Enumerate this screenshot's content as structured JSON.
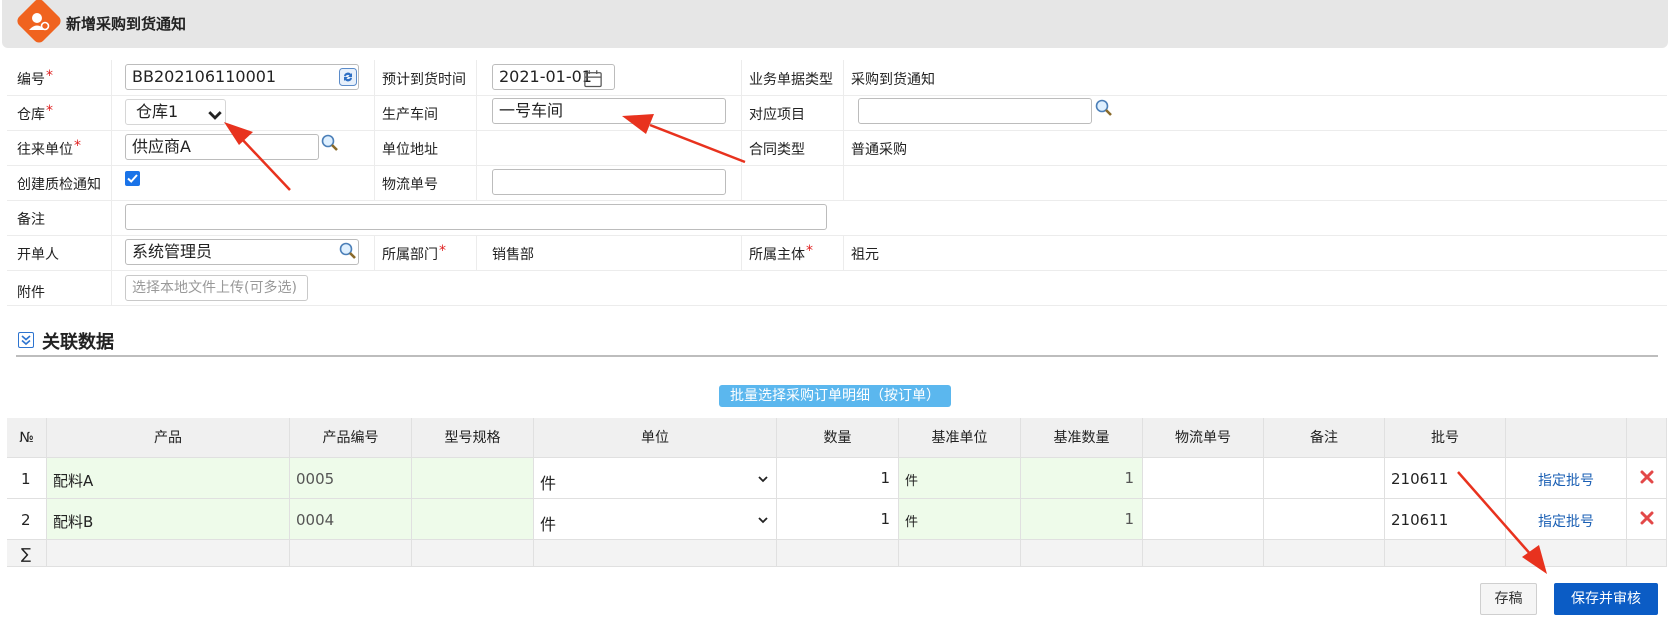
{
  "window": {
    "title": "新增采购到货通知"
  },
  "form": {
    "code_label": "编号",
    "code_value": "BB202106110001",
    "eta_label": "预计到货时间",
    "eta_value": "2021-01-01",
    "biz_type_label": "业务单据类型",
    "biz_type_value": "采购到货通知",
    "warehouse_label": "仓库",
    "warehouse_value": "仓库1",
    "workshop_label": "生产车间",
    "workshop_value": "一号车间",
    "project_label": "对应项目",
    "project_value": "",
    "partner_label": "往来单位",
    "partner_value": "供应商A",
    "address_label": "单位地址",
    "address_value": "",
    "contract_type_label": "合同类型",
    "contract_type_value": "普通采购",
    "qc_label": "创建质检通知",
    "qc_checked": true,
    "logistics_label": "物流单号",
    "logistics_value": "",
    "remark_label": "备注",
    "remark_value": "",
    "creator_label": "开单人",
    "creator_value": "系统管理员",
    "dept_label": "所属部门",
    "dept_value": "销售部",
    "entity_label": "所属主体",
    "entity_value": "祖元",
    "attach_label": "附件",
    "attach_button": "选择本地文件上传(可多选)",
    "required_mark": "*"
  },
  "related": {
    "section_title": "关联数据",
    "batch_button": "批量选择采购订单明细（按订单）"
  },
  "table": {
    "headers": [
      "№",
      "产品",
      "产品编号",
      "型号规格",
      "单位",
      "数量",
      "基准单位",
      "基准数量",
      "物流单号",
      "备注",
      "批号",
      "",
      ""
    ],
    "rows": [
      {
        "no": "1",
        "product": "配料A",
        "code": "0005",
        "spec": "",
        "unit": "件",
        "qty": "1",
        "base_unit": "件",
        "base_qty": "1",
        "logistics": "",
        "remark": "",
        "batch": "210611",
        "assign": "指定批号"
      },
      {
        "no": "2",
        "product": "配料B",
        "code": "0004",
        "spec": "",
        "unit": "件",
        "qty": "1",
        "base_unit": "件",
        "base_qty": "1",
        "logistics": "",
        "remark": "",
        "batch": "210611",
        "assign": "指定批号"
      }
    ],
    "sum_symbol": "∑"
  },
  "actions": {
    "draft": "存稿",
    "save_audit": "保存并审核"
  },
  "colors": {
    "accent": "#0b5cc5",
    "logo": "#f0631f",
    "batch_button": "#5bb7ee",
    "arrow": "#e8321e"
  }
}
